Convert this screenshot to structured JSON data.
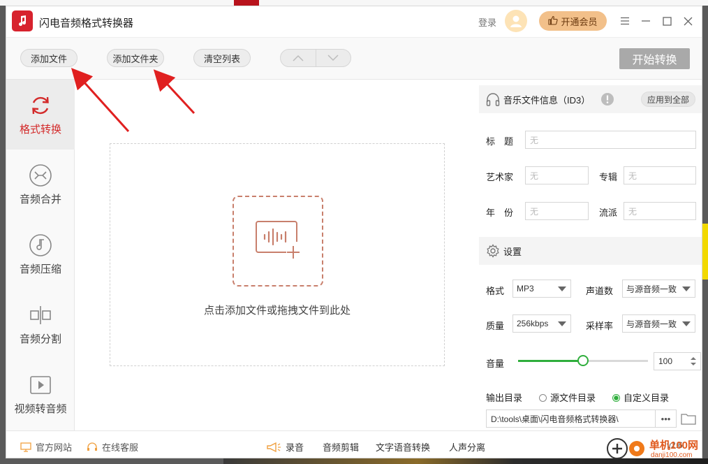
{
  "window": {
    "title": "闪电音频格式转换器",
    "login_label": "登录",
    "vip_label": "开通会员"
  },
  "toolbar": {
    "add_file": "添加文件",
    "add_folder": "添加文件夹",
    "clear_list": "清空列表",
    "start": "开始转换"
  },
  "sidebar": {
    "items": [
      {
        "label": "格式转换",
        "icon": "refresh-icon",
        "active": true
      },
      {
        "label": "音频合并",
        "icon": "merge-icon",
        "active": false
      },
      {
        "label": "音频压缩",
        "icon": "music-note-icon",
        "active": false
      },
      {
        "label": "音频分割",
        "icon": "split-icon",
        "active": false
      },
      {
        "label": "视频转音频",
        "icon": "video-play-icon",
        "active": false
      }
    ]
  },
  "dropzone": {
    "hint": "点击添加文件或拖拽文件到此处"
  },
  "id3": {
    "title": "音乐文件信息（ID3）",
    "apply_all": "应用到全部",
    "fields": {
      "title_label": "标　题",
      "title_value": "无",
      "artist_label": "艺术家",
      "artist_value": "无",
      "album_label": "专辑",
      "album_value": "无",
      "year_label": "年　份",
      "year_value": "无",
      "genre_label": "流派",
      "genre_value": "无"
    }
  },
  "settings": {
    "title": "设置",
    "format_label": "格式",
    "format_value": "MP3",
    "channels_label": "声道数",
    "channels_value": "与源音频一致",
    "quality_label": "质量",
    "quality_value": "256kbps",
    "samplerate_label": "采样率",
    "samplerate_value": "与源音频一致",
    "volume_label": "音量",
    "volume_value": "100",
    "volume_fraction": 0.5,
    "output_label": "输出目录",
    "output_source": "源文件目录",
    "output_custom": "自定义目录",
    "output_selected": "custom",
    "output_path": "D:\\tools\\桌面\\闪电音频格式转换器\\",
    "browse_dots": "•••"
  },
  "bottombar": {
    "website": "官方网站",
    "support": "在线客服",
    "record": "录音",
    "audio_edit": "音频剪辑",
    "tts": "文字语音转换",
    "vocal_split": "人声分离",
    "version": "v2.6"
  },
  "watermark": {
    "text": "单机100网",
    "sub": "danji100.com"
  },
  "colors": {
    "accent_red": "#d32a2a",
    "green": "#2fae3c",
    "vip_bg": "#f2c08a",
    "start_btn": "#a9a9a9"
  }
}
